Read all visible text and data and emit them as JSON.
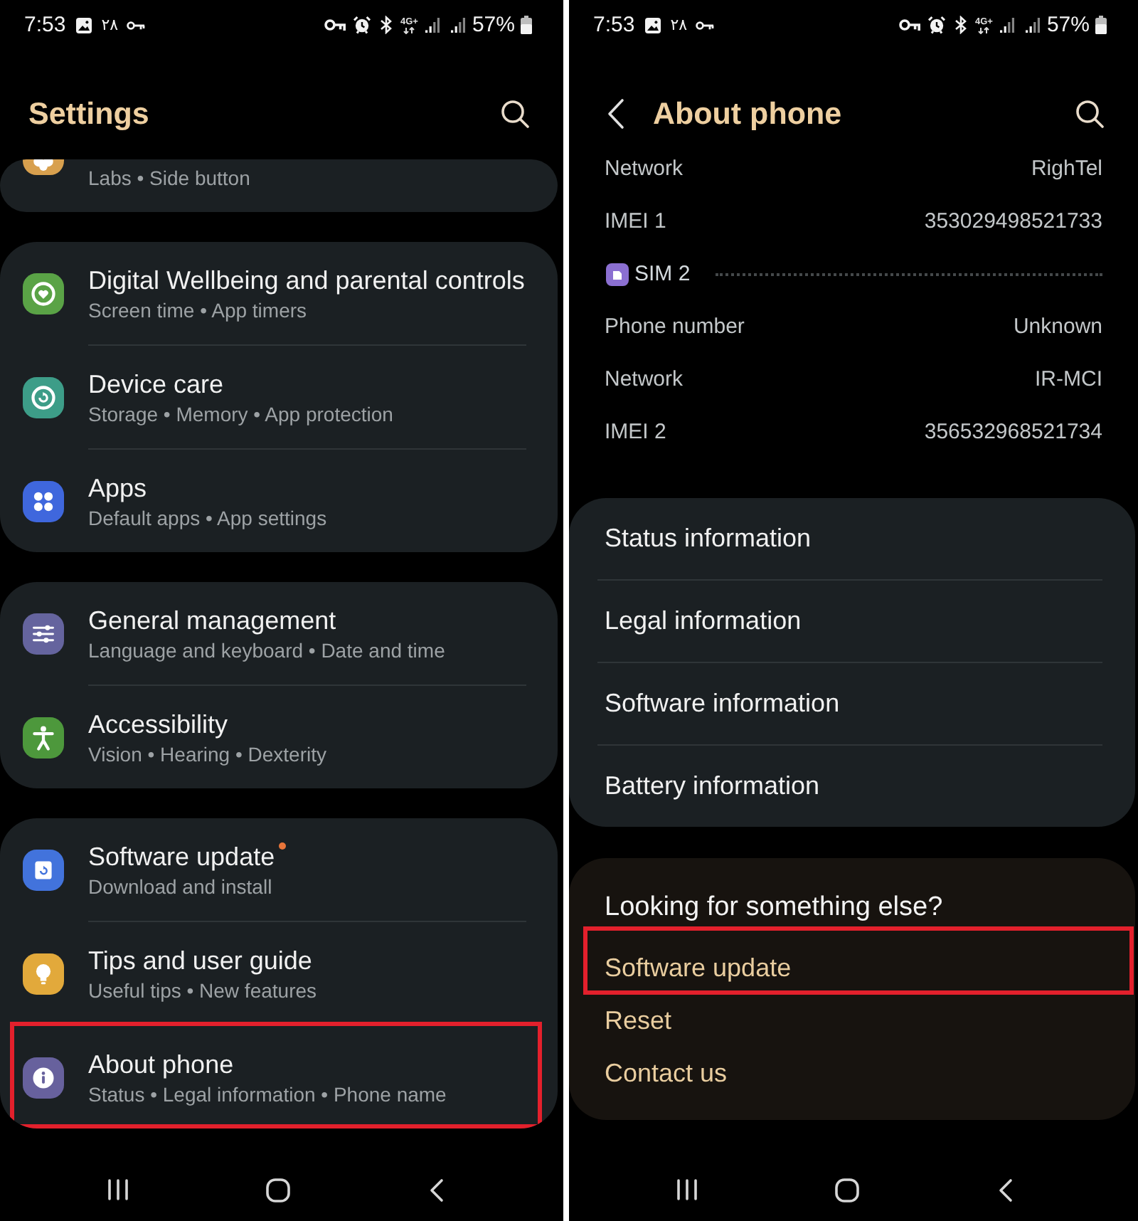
{
  "settings_screen": {
    "status_bar": {
      "time": "7:53",
      "notification": "۲۸",
      "network_type": "4G+",
      "battery": "57%"
    },
    "header": {
      "title": "Settings",
      "back_button": false
    },
    "groups": [
      {
        "items": [
          {
            "kind": "labs",
            "subtitle": "Labs • Side button",
            "badge": false,
            "highlighted": false
          }
        ]
      },
      {
        "items": [
          {
            "kind": "wellbeing",
            "title": "Digital Wellbeing and parental controls",
            "subtitle": "Screen time • App timers",
            "badge": false,
            "highlighted": false
          },
          {
            "kind": "device_care",
            "title": "Device care",
            "subtitle": "Storage • Memory • App protection",
            "badge": false,
            "highlighted": false
          },
          {
            "kind": "apps",
            "title": "Apps",
            "subtitle": "Default apps • App settings",
            "badge": false,
            "highlighted": false
          }
        ]
      },
      {
        "items": [
          {
            "kind": "general",
            "title": "General management",
            "subtitle": "Language and keyboard • Date and time",
            "badge": false,
            "highlighted": false
          },
          {
            "kind": "accessibility",
            "title": "Accessibility",
            "subtitle": "Vision • Hearing • Dexterity",
            "badge": false,
            "highlighted": false
          }
        ]
      },
      {
        "items": [
          {
            "kind": "update",
            "title": "Software update",
            "subtitle": "Download and install",
            "badge": true,
            "highlighted": false
          },
          {
            "kind": "tips",
            "title": "Tips and user guide",
            "subtitle": "Useful tips • New features",
            "badge": false,
            "highlighted": false
          },
          {
            "kind": "about",
            "title": "About phone",
            "subtitle": "Status • Legal information • Phone name",
            "badge": false,
            "highlighted": true
          }
        ]
      }
    ]
  },
  "about_phone_screen": {
    "status_bar": {
      "time": "7:53",
      "notification": "۲۸",
      "network_type": "4G+",
      "battery": "57%"
    },
    "header": {
      "title": "About phone",
      "back_button": true
    },
    "details": [
      {
        "kind": "row",
        "label": "Network",
        "value": "RighTel"
      },
      {
        "kind": "row",
        "label": "IMEI 1",
        "value": "353029498521733"
      },
      {
        "kind": "section",
        "label": "SIM 2"
      },
      {
        "kind": "row",
        "label": "Phone number",
        "value": "Unknown"
      },
      {
        "kind": "row",
        "label": "Network",
        "value": "IR-MCI"
      },
      {
        "kind": "row",
        "label": "IMEI 2",
        "value": "356532968521734"
      }
    ],
    "menu": [
      "Status information",
      "Legal information",
      "Software information",
      "Battery information"
    ],
    "suggestions": {
      "heading": "Looking for something else?",
      "links": [
        {
          "label": "Software update",
          "highlighted": true
        },
        {
          "label": "Reset",
          "highlighted": false
        },
        {
          "label": "Contact us",
          "highlighted": false
        }
      ]
    }
  }
}
